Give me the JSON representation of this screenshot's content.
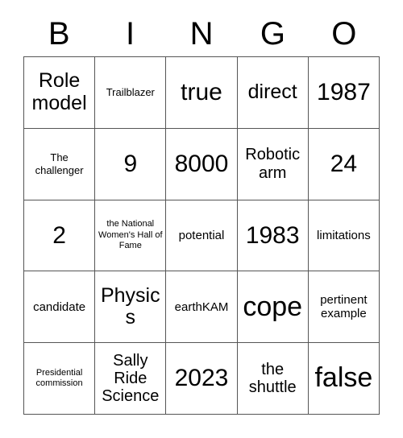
{
  "card": {
    "title": "BINGO",
    "columns": [
      "B",
      "I",
      "N",
      "G",
      "O"
    ],
    "border_color": "#555555",
    "text_color": "#000000",
    "background_color": "#ffffff",
    "rows": [
      [
        {
          "text": "Role model",
          "size": "fs-xl"
        },
        {
          "text": "Trailblazer",
          "size": "fs-sm"
        },
        {
          "text": "true",
          "size": "fs-xxl"
        },
        {
          "text": "direct",
          "size": "fs-xl"
        },
        {
          "text": "1987",
          "size": "fs-xxl"
        }
      ],
      [
        {
          "text": "The challenger",
          "size": "fs-sm"
        },
        {
          "text": "9",
          "size": "fs-xxl"
        },
        {
          "text": "8000",
          "size": "fs-xxl"
        },
        {
          "text": "Robotic arm",
          "size": "fs-lg"
        },
        {
          "text": "24",
          "size": "fs-xxl"
        }
      ],
      [
        {
          "text": "2",
          "size": "fs-xxl"
        },
        {
          "text": "the National Women's Hall of Fame",
          "size": "fs-xs"
        },
        {
          "text": "potential",
          "size": "fs-md"
        },
        {
          "text": "1983",
          "size": "fs-xxl"
        },
        {
          "text": "limitations",
          "size": "fs-md"
        }
      ],
      [
        {
          "text": "candidate",
          "size": "fs-md"
        },
        {
          "text": "Physics",
          "size": "fs-xl"
        },
        {
          "text": "earthKAM",
          "size": "fs-md"
        },
        {
          "text": "cope",
          "size": "fs-hg"
        },
        {
          "text": "pertinent example",
          "size": "fs-md"
        }
      ],
      [
        {
          "text": "Presidential commission",
          "size": "fs-xs"
        },
        {
          "text": "Sally Ride Science",
          "size": "fs-lg"
        },
        {
          "text": "2023",
          "size": "fs-xxl"
        },
        {
          "text": "the shuttle",
          "size": "fs-lg"
        },
        {
          "text": "false",
          "size": "fs-hg"
        }
      ]
    ]
  }
}
